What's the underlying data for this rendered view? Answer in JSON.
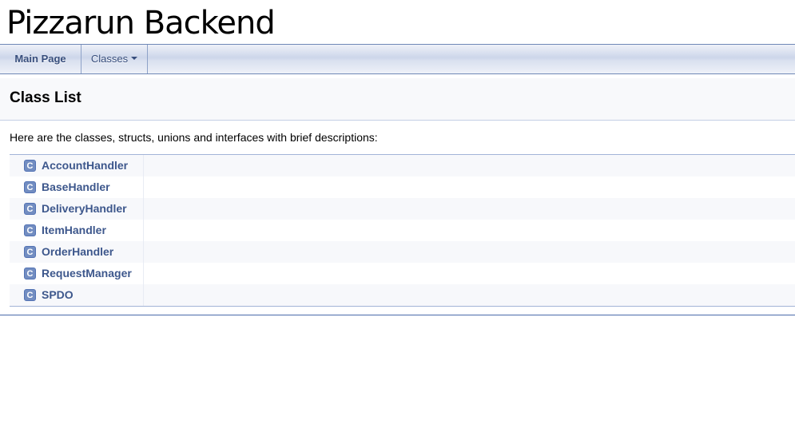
{
  "project": {
    "title": "Pizzarun Backend"
  },
  "nav": {
    "main_page": "Main Page",
    "classes": "Classes"
  },
  "page": {
    "title": "Class List",
    "intro": "Here are the classes, structs, unions and interfaces with brief descriptions:"
  },
  "class_badge": "C",
  "classes": [
    {
      "name": "AccountHandler"
    },
    {
      "name": "BaseHandler"
    },
    {
      "name": "DeliveryHandler"
    },
    {
      "name": "ItemHandler"
    },
    {
      "name": "OrderHandler"
    },
    {
      "name": "RequestManager"
    },
    {
      "name": "SPDO"
    }
  ],
  "colors": {
    "link": "#3d578c",
    "nav_text": "#364d7c",
    "badge": "#728dc1"
  }
}
